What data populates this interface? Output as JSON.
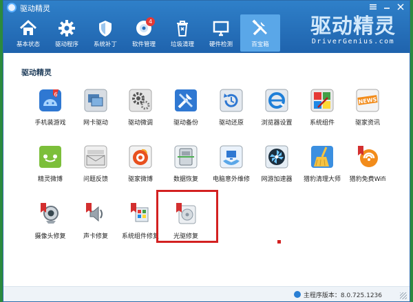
{
  "window": {
    "title": "驱动精灵"
  },
  "toolbar": {
    "items": [
      {
        "label": "基本状态",
        "icon": "home-icon"
      },
      {
        "label": "驱动程序",
        "icon": "gear-icon"
      },
      {
        "label": "系统补丁",
        "icon": "shield-icon"
      },
      {
        "label": "软件管理",
        "icon": "disc-icon",
        "badge": "4"
      },
      {
        "label": "垃圾清理",
        "icon": "trash-icon"
      },
      {
        "label": "硬件检测",
        "icon": "monitor-icon"
      },
      {
        "label": "百宝箱",
        "icon": "tools-icon",
        "active": true
      }
    ]
  },
  "brand": {
    "cn": "驱动精灵",
    "en": "DriverGenius.com"
  },
  "section": {
    "title": "驱动精灵"
  },
  "tools": [
    {
      "label": "手机装游戏",
      "icon": "android-phone-icon"
    },
    {
      "label": "网卡驱动",
      "icon": "network-card-icon"
    },
    {
      "label": "驱动微调",
      "icon": "gears-icon"
    },
    {
      "label": "驱动备份",
      "icon": "wrench-icon"
    },
    {
      "label": "驱动还原",
      "icon": "restore-icon"
    },
    {
      "label": "浏览器设置",
      "icon": "browser-icon"
    },
    {
      "label": "系统组件",
      "icon": "system-component-icon"
    },
    {
      "label": "驱家资讯",
      "icon": "news-icon"
    },
    {
      "label": "精灵微博",
      "icon": "smile-chat-icon"
    },
    {
      "label": "问题反馈",
      "icon": "envelope-icon"
    },
    {
      "label": "驱家微博",
      "icon": "weibo-icon"
    },
    {
      "label": "数据恢复",
      "icon": "data-recovery-icon"
    },
    {
      "label": "电脑意外维修",
      "icon": "repair-hands-icon"
    },
    {
      "label": "网游加速器",
      "icon": "fan-icon"
    },
    {
      "label": "猎豹清理大师",
      "icon": "broom-icon"
    },
    {
      "label": "猎豹免费Wifi",
      "icon": "wifi-icon"
    },
    {
      "label": "摄像头修复",
      "icon": "webcam-icon"
    },
    {
      "label": "声卡修复",
      "icon": "speaker-icon"
    },
    {
      "label": "系统组件修复",
      "icon": "windows-repair-icon"
    },
    {
      "label": "光驱修复",
      "icon": "optical-drive-icon"
    }
  ],
  "status": {
    "version_text": "主程序版本：8.0.725.1236"
  },
  "colors": {
    "header": "#2670bd",
    "active_tab": "#5aa7e8",
    "highlight": "#d32020"
  }
}
